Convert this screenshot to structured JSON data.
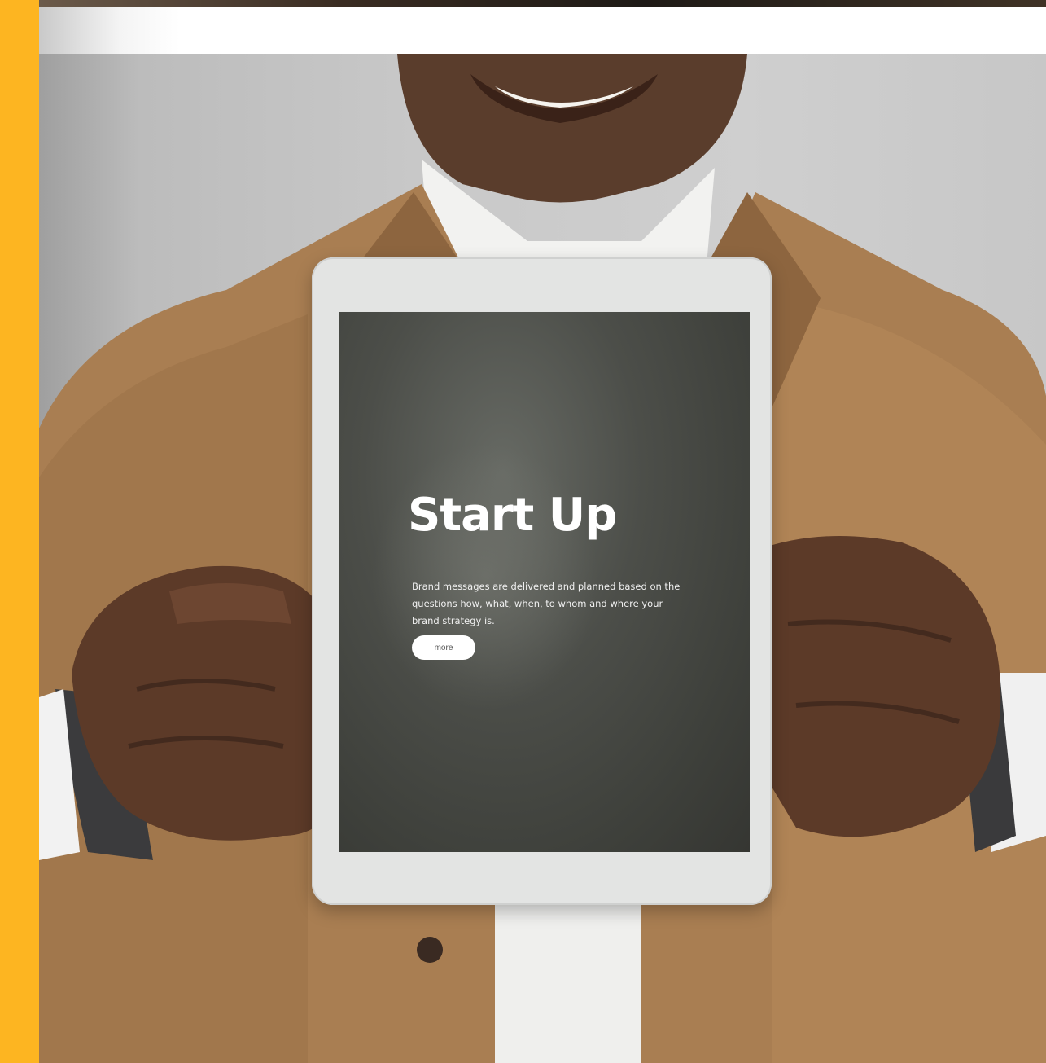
{
  "tablet_screen": {
    "title": "Start Up",
    "body": "Brand messages are delivered and planned based on the questions how, what, when, to whom and where your brand strategy is.",
    "button_label": "more"
  },
  "colors": {
    "accent_bar": "#fdb521",
    "jacket": "#a97e52",
    "screen": "#45474300"
  }
}
